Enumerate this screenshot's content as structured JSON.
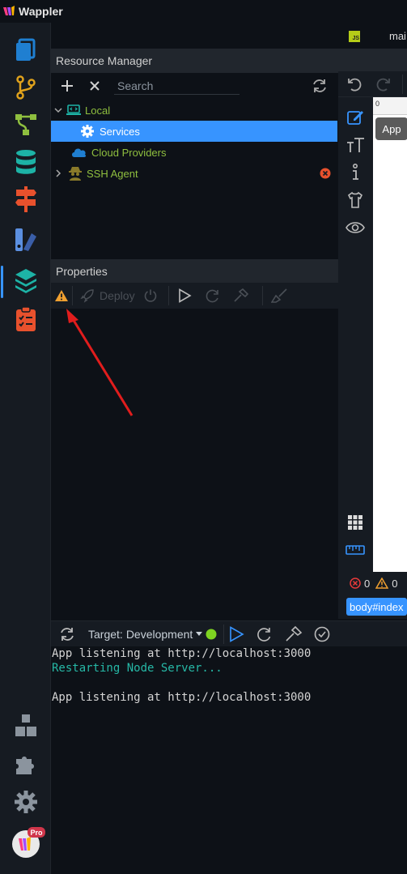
{
  "app": {
    "name": "Wappler"
  },
  "editor_tab": {
    "label": "mai",
    "badge": "JS"
  },
  "resource_manager": {
    "title": "Resource Manager",
    "search_placeholder": "Search",
    "tree": [
      {
        "label": "Local",
        "expanded": true,
        "color": "#8fbf3f"
      },
      {
        "label": "Services",
        "selected": true,
        "color": "#ffffff"
      },
      {
        "label": "Cloud Providers",
        "color": "#8fbf3f"
      },
      {
        "label": "SSH Agent",
        "expanded": false,
        "color": "#8fbf3f"
      }
    ]
  },
  "properties": {
    "title": "Properties",
    "deploy_label": "Deploy"
  },
  "design": {
    "ruler_zero": "0",
    "tooltip": "App",
    "error_count": "0",
    "warning_count": "0",
    "breadcrumb": "body#index"
  },
  "terminal_toolbar": {
    "target_label": "Target:",
    "target_value": "Development"
  },
  "terminal": {
    "lines": [
      {
        "text": "App listening at http://localhost:3000",
        "style": "info"
      },
      {
        "text": "Restarting Node Server...",
        "style": "accent"
      },
      {
        "text": "",
        "style": "info"
      },
      {
        "text": "App listening at http://localhost:3000",
        "style": "info"
      }
    ]
  },
  "badges": {
    "pro": "Pro"
  },
  "colors": {
    "accent": "#3794ff",
    "warning": "#f0a030",
    "error": "#e8512d",
    "green": "#8fbf3f",
    "status_green": "#7ed321"
  }
}
